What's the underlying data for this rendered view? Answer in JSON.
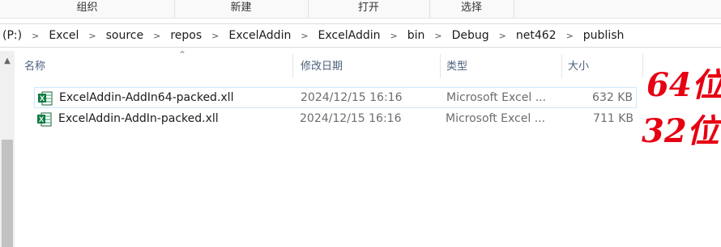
{
  "ribbon": {
    "groups": [
      "组织",
      "新建",
      "打开",
      "选择"
    ]
  },
  "address_bar": {
    "drive": "(P:)",
    "segments": [
      "Excel",
      "source",
      "repos",
      "ExcelAddin",
      "ExcelAddin",
      "bin",
      "Debug",
      "net462",
      "publish"
    ]
  },
  "columns": {
    "name": "名称",
    "date": "修改日期",
    "type": "类型",
    "size": "大小"
  },
  "files": [
    {
      "name": "ExcelAddin-AddIn64-packed.xll",
      "date": "2024/12/15 16:16",
      "type": "Microsoft Excel ...",
      "size": "632 KB",
      "selected": true
    },
    {
      "name": "ExcelAddin-AddIn-packed.xll",
      "date": "2024/12/15 16:16",
      "type": "Microsoft Excel ...",
      "size": "711 KB",
      "selected": false
    }
  ],
  "annotations": {
    "label_64": "64位",
    "label_32": "32位",
    "color": "#e60012"
  },
  "icons": {
    "file_icon": "excel-xll-icon",
    "sort_indicator": "sort-up-icon",
    "scroll_up": "scroll-up-icon",
    "chevron": "chevron-right-icon"
  }
}
